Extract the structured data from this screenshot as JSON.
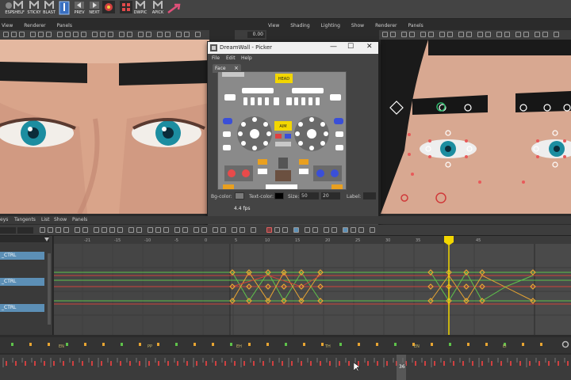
{
  "shelf": {
    "buttons": [
      {
        "label": "ESP",
        "color": "#dddddd"
      },
      {
        "label": "SHELF",
        "color": "#dddddd"
      },
      {
        "label": "STICKY",
        "color": "#dddddd"
      },
      {
        "label": "BLAST",
        "color": "#dddddd"
      },
      {
        "label": "",
        "color": "#5a8fd6"
      },
      {
        "label": "PREV",
        "color": "#dddddd"
      },
      {
        "label": "NEXT",
        "color": "#dddddd"
      },
      {
        "label": "",
        "color": "#d04040"
      },
      {
        "label": "DWPIC",
        "color": "#dddddd"
      },
      {
        "label": "APICK",
        "color": "#dddddd"
      }
    ]
  },
  "left_panel": {
    "menu": [
      "View",
      "Renderer",
      "Panels"
    ]
  },
  "right_panel": {
    "menu": [
      "View",
      "Shading",
      "Lighting",
      "Show",
      "Renderer",
      "Panels"
    ],
    "field_value": "0.00"
  },
  "picker": {
    "title": "DreamWall - Picker",
    "menu": [
      "File",
      "Edit",
      "Help"
    ],
    "tab_label": "Face",
    "head_label": "HEAD",
    "aim_label": "AIM",
    "bg_color_label": "Bg-color:",
    "text_color_label": "Text-color:",
    "size_label": "Size:",
    "size_w": "50",
    "size_h": "20",
    "label_label": "Label:",
    "fps_text": "4.4 fps"
  },
  "graph_editor": {
    "menu": [
      "eys",
      "Tangents",
      "List",
      "Show",
      "Panels"
    ],
    "outliner_items": [
      "_CTRL",
      "_CTRL",
      "_CTRL"
    ],
    "ruler_labels": [
      "-21",
      "-15",
      "-10",
      "-5",
      "0",
      "5",
      "10",
      "15",
      "20",
      "25",
      "30",
      "35",
      "40",
      "45"
    ],
    "current_frame": "36"
  },
  "timeline": {
    "key_labels": [
      "EN",
      "PP",
      "EH",
      "TH",
      "EN",
      "EI"
    ],
    "current_frame": "36"
  },
  "colors": {
    "accent_yellow": "#f2d600",
    "curve_green": "#5ec24a",
    "curve_red": "#d0423a",
    "key_orange": "#e8a532",
    "selection_blue": "#5c8fb6"
  }
}
